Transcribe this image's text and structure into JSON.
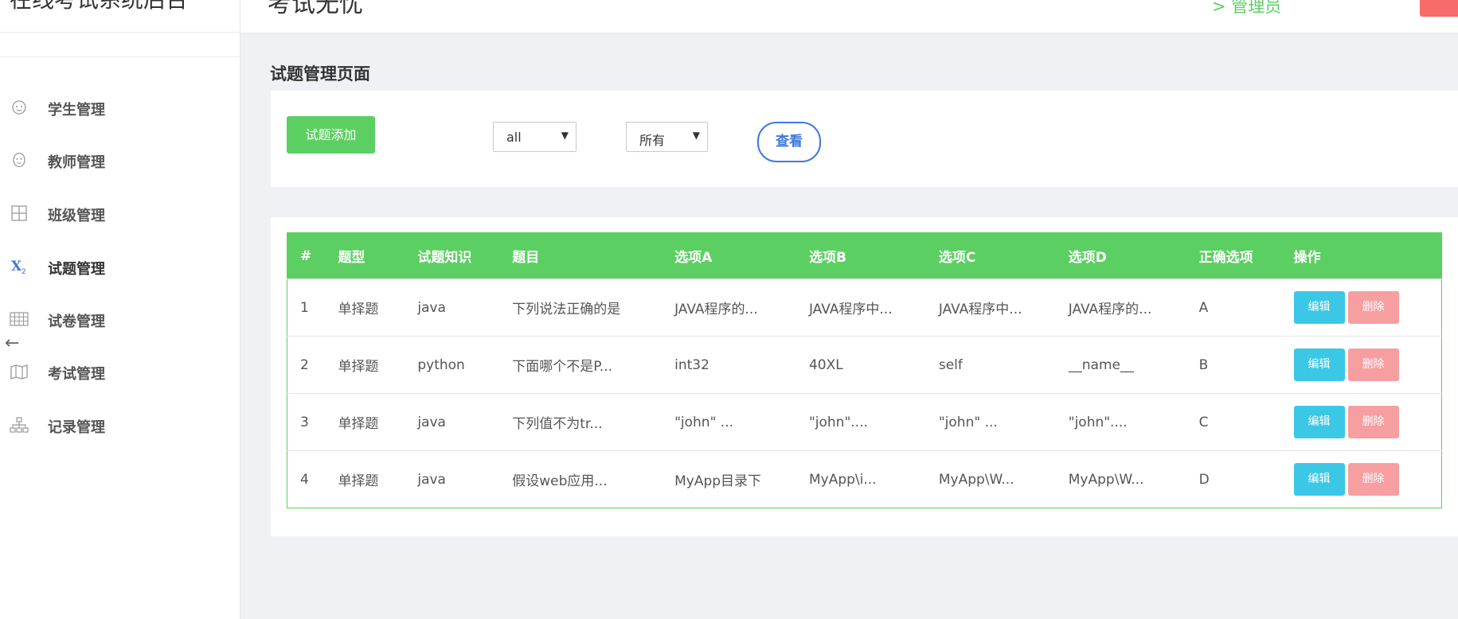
{
  "sidebar": {
    "title": "在线考试系统后台",
    "items": [
      {
        "label": "学生管理",
        "icon": "baby-face-icon"
      },
      {
        "label": "教师管理",
        "icon": "face-icon"
      },
      {
        "label": "班级管理",
        "icon": "grid-icon"
      },
      {
        "label": "试题管理",
        "icon": "subscript-x-icon"
      },
      {
        "label": "试卷管理",
        "icon": "table-icon"
      },
      {
        "label": "考试管理",
        "icon": "map-icon"
      },
      {
        "label": "记录管理",
        "icon": "org-chart-icon"
      }
    ],
    "active_index": 3
  },
  "topbar": {
    "title": "考试无忧",
    "user": "> 管理员"
  },
  "page": {
    "heading": "试题管理页面"
  },
  "filters": {
    "add_label": "试题添加",
    "select1_value": "all",
    "select2_value": "所有",
    "view_label": "查看"
  },
  "table": {
    "headers": [
      "#",
      "题型",
      "试题知识",
      "题目",
      "选项A",
      "选项B",
      "选项C",
      "选项D",
      "正确选项",
      "操作"
    ],
    "rows": [
      {
        "id": "1",
        "type": "单择题",
        "knowledge": "java",
        "question": "下列说法正确的是",
        "a": "JAVA程序的...",
        "b": "JAVA程序中...",
        "c": "JAVA程序中...",
        "d": "JAVA程序的...",
        "answer": "A"
      },
      {
        "id": "2",
        "type": "单择题",
        "knowledge": "python",
        "question": "下面哪个不是P...",
        "a": "int32",
        "b": "40XL",
        "c": "self",
        "d": "__name__",
        "answer": "B"
      },
      {
        "id": "3",
        "type": "单择题",
        "knowledge": "java",
        "question": "下列值不为tr...",
        "a": "\"john\" ...",
        "b": "\"john\"....",
        "c": "\"john\" ...",
        "d": "\"john\"....",
        "answer": "C"
      },
      {
        "id": "4",
        "type": "单择题",
        "knowledge": "java",
        "question": "假设web应用...",
        "a": "MyApp目录下",
        "b": "MyApp\\i...",
        "c": "MyApp\\W...",
        "d": "MyApp\\W...",
        "answer": "D"
      }
    ],
    "edit_label": "编辑",
    "delete_label": "删除"
  },
  "colors": {
    "primary_green": "#5ccf62",
    "blue": "#3e7ae0",
    "cyan": "#3bc8e7",
    "pink": "#f79ea1",
    "background": "#eff1f5"
  }
}
